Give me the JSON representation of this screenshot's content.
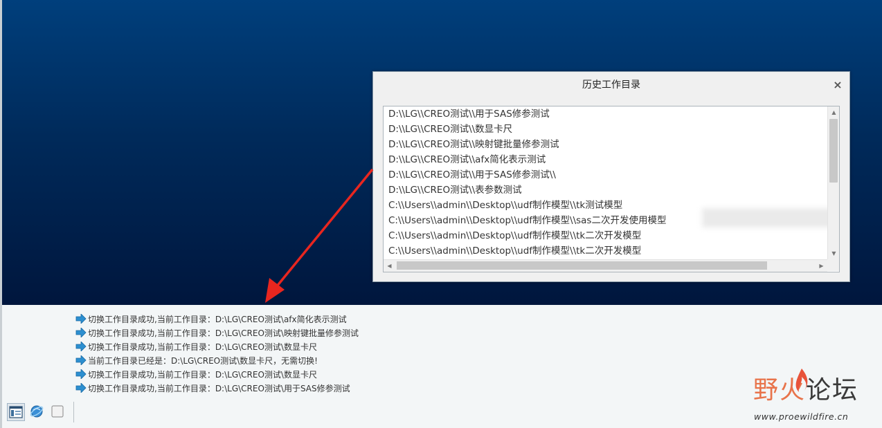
{
  "dialog": {
    "title": "历史工作目录",
    "close_label": "×",
    "items": [
      "D:\\\\LG\\\\CREO测试\\\\用于SAS修参测试",
      "D:\\\\LG\\\\CREO测试\\\\数显卡尺",
      "D:\\\\LG\\\\CREO测试\\\\映射键批量修参测试",
      "D:\\\\LG\\\\CREO测试\\\\afx简化表示测试",
      "D:\\\\LG\\\\CREO测试\\\\用于SAS修参测试\\\\",
      "D:\\\\LG\\\\CREO测试\\\\表参数测试",
      "C:\\\\Users\\\\admin\\\\Desktop\\\\udf制作模型\\\\tk测试模型",
      "C:\\\\Users\\\\admin\\\\Desktop\\\\udf制作模型\\\\sas二次开发使用模型",
      "C:\\\\Users\\\\admin\\\\Desktop\\\\udf制作模型\\\\tk二次开发模型",
      "C:\\\\Users\\\\admin\\\\Desktop\\\\udf制作模型\\\\tk二次开发模型"
    ]
  },
  "messages": [
    "切换工作目录成功,当前工作目录：D:\\LG\\CREO测试\\afx简化表示测试",
    "切换工作目录成功,当前工作目录：D:\\LG\\CREO测试\\映射键批量修参测试",
    "切换工作目录成功,当前工作目录：D:\\LG\\CREO测试\\数显卡尺",
    "当前工作目录已经是：D:\\LG\\CREO测试\\数显卡尺，无需切换!",
    "切换工作目录成功,当前工作目录：D:\\LG\\CREO测试\\数显卡尺",
    "切换工作目录成功,当前工作目录：D:\\LG\\CREO测试\\用于SAS修参测试"
  ],
  "statusbar": {
    "icons": [
      "model-tree-toggle-icon",
      "browser-icon",
      "full-screen-icon"
    ]
  },
  "watermark": {
    "title_part1": "野火",
    "title_part2": "论坛",
    "url": "www.proewildfire.cn"
  },
  "colors": {
    "graphics_top": "#003f7c",
    "graphics_bottom": "#00163d",
    "arrow": "#e8261f",
    "watermark_accent": "#e8734a"
  }
}
